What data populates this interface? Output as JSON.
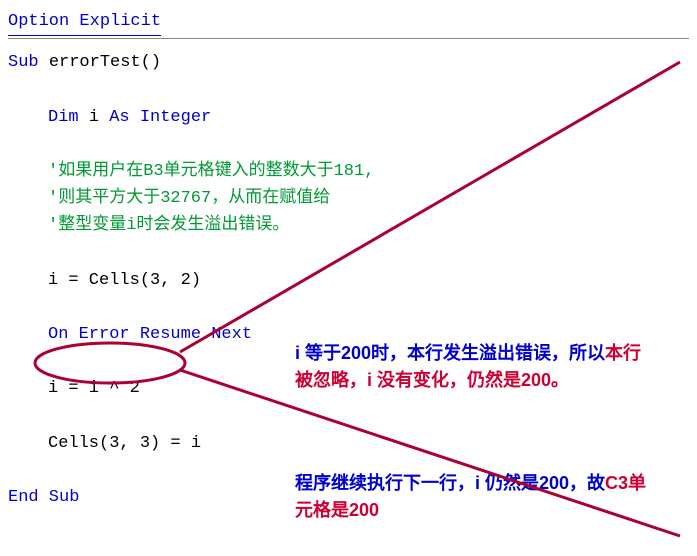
{
  "code": {
    "line1": "Option Explicit",
    "line2_kw": "Sub ",
    "line2_id": "errorTest()",
    "line3_kw": "Dim ",
    "line3_id": "i ",
    "line3_kw2": "As Integer",
    "comment1": "'如果用户在B3单元格键入的整数大于181,",
    "comment2": "'则其平方大于32767，从而在赋值给",
    "comment3": "'整型变量i时会发生溢出错误。",
    "line4": "i = Cells(3, 2)",
    "line5_kw": "On Error Resume Next",
    "line6": "i = i ^ 2",
    "line7": "Cells(3, 3) = i",
    "line8": "End Sub"
  },
  "annotations": {
    "a1_p1": "i 等于200时，本行发生溢出错误，所以",
    "a1_red": "本行被忽略，i 没有变化，仍然是200。",
    "a2_p1": "程序继续执行下一行，i 仍然是200，故",
    "a2_red": "C3单元格是200"
  },
  "watermark": ""
}
